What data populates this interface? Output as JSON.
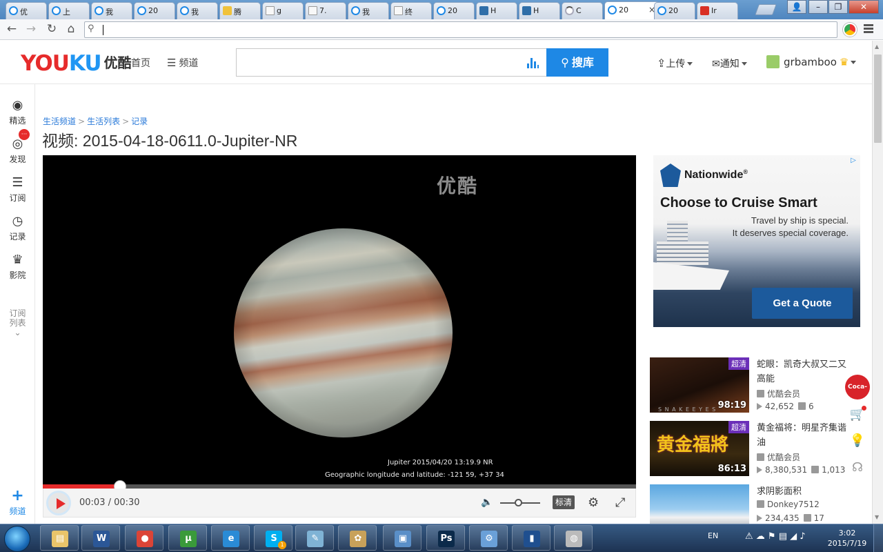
{
  "browser": {
    "tabs": [
      {
        "label": "优",
        "icon": "youku-icon"
      },
      {
        "label": "上",
        "icon": "youku-icon"
      },
      {
        "label": "我",
        "icon": "youku-icon"
      },
      {
        "label": "20",
        "icon": "youku-icon"
      },
      {
        "label": "我",
        "icon": "youku-icon"
      },
      {
        "label": "腾",
        "icon": "weather-icon"
      },
      {
        "label": "g",
        "icon": "document-icon"
      },
      {
        "label": "7.",
        "icon": "document-icon"
      },
      {
        "label": "我",
        "icon": "youku-icon"
      },
      {
        "label": "终",
        "icon": "document-icon"
      },
      {
        "label": "20",
        "icon": "youku-icon"
      },
      {
        "label": "H",
        "icon": "n-icon"
      },
      {
        "label": "H",
        "icon": "n-icon"
      },
      {
        "label": "C",
        "icon": "loading-icon"
      },
      {
        "label": "20",
        "icon": "youku-icon",
        "active": true
      },
      {
        "label": "20",
        "icon": "youku-icon"
      },
      {
        "label": "Ir",
        "icon": "gmail-icon"
      }
    ],
    "close_tab_glyph": "×",
    "window_buttons": {
      "user": "👤",
      "minimize": "–",
      "restore": "❐",
      "close": "✕"
    },
    "nav": {
      "back": "←",
      "forward": "→",
      "reload": "↻",
      "home": "⌂"
    },
    "address_value": ""
  },
  "header": {
    "logo_text_1": "YOU",
    "logo_text_2": "KU",
    "logo_cn": "优酷",
    "nav_home": "首页",
    "nav_channels": "频道",
    "search_placeholder": "",
    "search_button": "搜库",
    "upload": "上传",
    "notify": "通知",
    "username": "grbamboo"
  },
  "sidebar": {
    "items": [
      {
        "label": "精选",
        "icon": "play-circle-icon",
        "glyph": "◉"
      },
      {
        "label": "发现",
        "icon": "eye-icon",
        "glyph": "◎"
      },
      {
        "label": "订阅",
        "icon": "rss-icon",
        "glyph": "☰"
      },
      {
        "label": "记录",
        "icon": "clock-icon",
        "glyph": "◷"
      },
      {
        "label": "影院",
        "icon": "crown-icon",
        "glyph": "♛"
      }
    ],
    "subscribe_badge": "···",
    "sub_list_line1": "订阅",
    "sub_list_line2": "列表",
    "sub_list_more": "⌄",
    "add_glyph": "+",
    "add_label": "频道"
  },
  "breadcrumb": [
    "生活频道",
    "生活列表",
    "记录"
  ],
  "breadcrumb_sep": ">",
  "video": {
    "title": "视频: 2015-04-18-0611.0-Jupiter-NR",
    "watermark": "优酷",
    "caption_line1": "Jupiter 2015/04/20 13:19.9 NR",
    "caption_line2": "Geographic longitude and latitude: -121 59, +37 34",
    "time": "00:03 / 00:30",
    "progress_fraction": 0.13,
    "volume_fraction": 0.45,
    "quality": "标清"
  },
  "ad": {
    "info_glyph": "▷",
    "brand": "Nationwide",
    "brand_mark": "®",
    "headline": "Choose to Cruise Smart",
    "sub1": "Travel by ship is special.",
    "sub2": "It deserves special coverage.",
    "cta": "Get a Quote"
  },
  "recommendations": [
    {
      "title": "蛇眼：凯奇大叔又二又高能",
      "badge": "超清",
      "duration": "98:19",
      "author": "优酷会员",
      "views": "42,652",
      "comments": "6",
      "thumb_caption": "S N A K E E Y E S"
    },
    {
      "title": "黄金福将：明星齐集谐油",
      "badge": "超清",
      "duration": "86:13",
      "author": "优酷会员",
      "views": "8,380,531",
      "comments": "1,013",
      "thumb_caption": "黄金福將"
    },
    {
      "title": "求阴影面积",
      "badge": "",
      "duration": "",
      "author": "Donkey7512",
      "views": "234,435",
      "comments": "17",
      "thumb_caption": ""
    }
  ],
  "float_bar": {
    "coke": "Coca-Cola",
    "cart": "🛒",
    "idea": "💡",
    "service": "☊"
  },
  "taskbar": {
    "apps": [
      {
        "name": "explorer",
        "glyph": "▤",
        "color": "#e9c46a"
      },
      {
        "name": "word",
        "glyph": "W",
        "color": "#2b5797"
      },
      {
        "name": "chrome",
        "glyph": "●",
        "color": "#db4437"
      },
      {
        "name": "utorrent",
        "glyph": "µ",
        "color": "#3a9a3a"
      },
      {
        "name": "ie",
        "glyph": "e",
        "color": "#2a8bd6"
      },
      {
        "name": "skype",
        "glyph": "S",
        "color": "#00aff0"
      },
      {
        "name": "notes",
        "glyph": "✎",
        "color": "#7fb3d5"
      },
      {
        "name": "paint",
        "glyph": "✿",
        "color": "#c8a15a"
      },
      {
        "name": "photo-viewer",
        "glyph": "▣",
        "color": "#5a8fc8"
      },
      {
        "name": "photoshop",
        "glyph": "Ps",
        "color": "#0b2a4a"
      },
      {
        "name": "control-panel",
        "glyph": "⚙",
        "color": "#6aa0d8"
      },
      {
        "name": "film",
        "glyph": "▮",
        "color": "#1f4f8f"
      },
      {
        "name": "disc",
        "glyph": "◍",
        "color": "#bbbbbb"
      }
    ],
    "skype_badge": "1",
    "lang": "EN",
    "clock_time": "3:02",
    "clock_date": "2015/7/19"
  }
}
